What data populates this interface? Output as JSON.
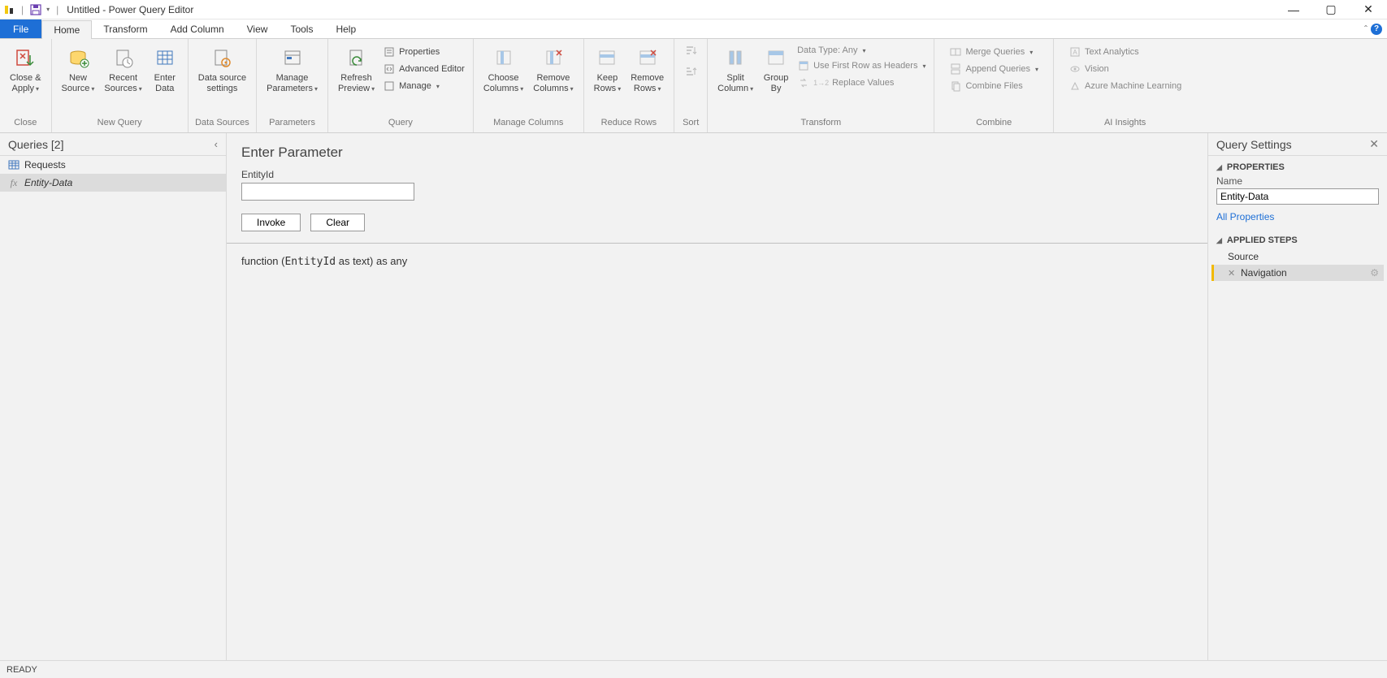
{
  "window": {
    "title": "Untitled - Power Query Editor"
  },
  "menu": {
    "file": "File",
    "home": "Home",
    "transform": "Transform",
    "add_column": "Add Column",
    "view": "View",
    "tools": "Tools",
    "help": "Help"
  },
  "ribbon": {
    "close": {
      "close_apply": "Close &\nApply",
      "group": "Close"
    },
    "new_query": {
      "new_source": "New\nSource",
      "recent_sources": "Recent\nSources",
      "enter_data": "Enter\nData",
      "group": "New Query"
    },
    "data_sources": {
      "settings": "Data source\nsettings",
      "group": "Data Sources"
    },
    "parameters": {
      "manage": "Manage\nParameters",
      "group": "Parameters"
    },
    "query": {
      "refresh": "Refresh\nPreview",
      "properties": "Properties",
      "advanced": "Advanced Editor",
      "manage": "Manage",
      "group": "Query"
    },
    "manage_columns": {
      "choose": "Choose\nColumns",
      "remove": "Remove\nColumns",
      "group": "Manage Columns"
    },
    "reduce_rows": {
      "keep": "Keep\nRows",
      "remove": "Remove\nRows",
      "group": "Reduce Rows"
    },
    "sort": {
      "group": "Sort"
    },
    "transform": {
      "split": "Split\nColumn",
      "group_by": "Group\nBy",
      "data_type": "Data Type: Any",
      "first_row": "Use First Row as Headers",
      "replace": "Replace Values",
      "group": "Transform"
    },
    "combine": {
      "merge": "Merge Queries",
      "append": "Append Queries",
      "files": "Combine Files",
      "group": "Combine"
    },
    "ai": {
      "text": "Text Analytics",
      "vision": "Vision",
      "azure": "Azure Machine Learning",
      "group": "AI Insights"
    }
  },
  "left_panel": {
    "title": "Queries [2]",
    "items": [
      {
        "name": "Requests",
        "kind": "table"
      },
      {
        "name": "Entity-Data",
        "kind": "function",
        "selected": true
      }
    ]
  },
  "center": {
    "title": "Enter Parameter",
    "param_label": "EntityId",
    "param_value": "",
    "invoke": "Invoke",
    "clear": "Clear",
    "signature_prefix": "function (",
    "signature_param": "EntityId",
    "signature_middle": " as text) as any"
  },
  "right_panel": {
    "title": "Query Settings",
    "properties_section": "PROPERTIES",
    "name_label": "Name",
    "name_value": "Entity-Data",
    "all_properties": "All Properties",
    "steps_section": "APPLIED STEPS",
    "steps": [
      {
        "label": "Source"
      },
      {
        "label": "Navigation",
        "selected": true,
        "deletable": true
      }
    ]
  },
  "status": {
    "ready": "READY"
  }
}
